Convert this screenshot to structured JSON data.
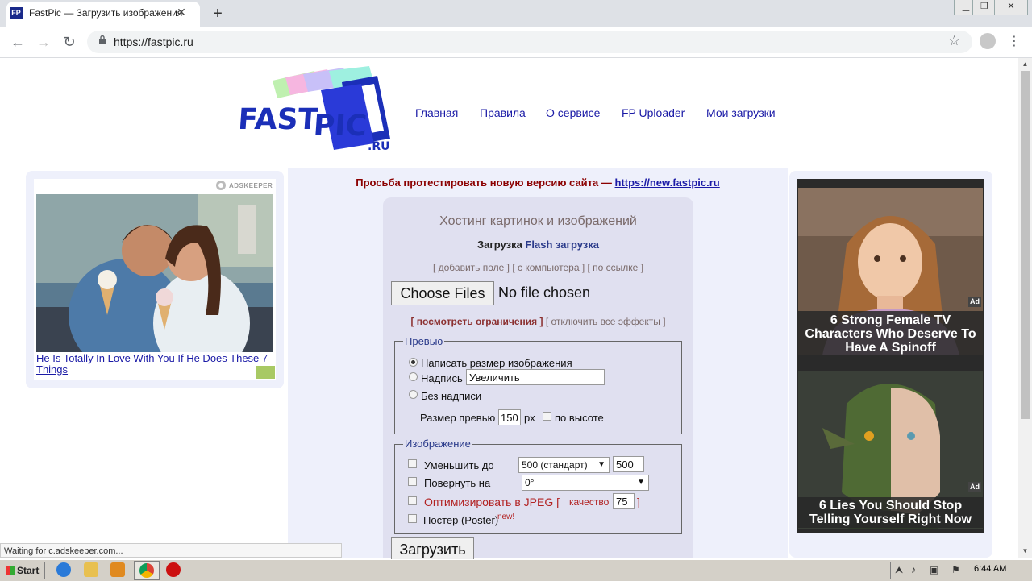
{
  "browser": {
    "tab_title": "FastPic — Загрузить изображения",
    "favicon_text": "FP",
    "url": "https://fastpic.ru",
    "status_text": "Waiting for c.adskeeper.com..."
  },
  "site": {
    "nav": [
      "Главная",
      "Правила",
      "О сервисе",
      "FP Uploader",
      "Мои загрузки"
    ],
    "notice_text": "Просьба протестировать новую версию сайта — ",
    "notice_link": "https://new.fastpic.ru"
  },
  "left_ad": {
    "brand": "ADSKEEPER",
    "headline": "He Is Totally In Love With You If He Does These 7 Things"
  },
  "upload": {
    "title": "Хостинг картинок и изображений",
    "mode_label": "Загрузка",
    "flash_label": "Flash загрузка",
    "options": "[ добавить поле ] [ с компьютера ] [ по ссылке ]",
    "choose_files": "Choose Files",
    "no_file": "No file chosen",
    "limits": "[ посмотреть ограничения ]",
    "effects": " [ отключить все эффекты ]",
    "preview": {
      "legend": "Превью",
      "opt1": "Написать размер изображения",
      "opt2": "Надпись",
      "opt2_value": "Увеличить",
      "opt3": "Без надписи",
      "size_label": "Размер превью",
      "size_value": "150",
      "size_unit": "px",
      "by_height": "по высоте"
    },
    "image": {
      "legend": "Изображение",
      "resize": "Уменьшить до",
      "resize_select": "500 (стандарт)",
      "resize_value": "500",
      "rotate": "Повернуть на",
      "rotate_select": "0°",
      "optimize": "Оптимизировать в JPEG [",
      "quality_label": "качество",
      "quality_value": "75",
      "bracket_close": "]",
      "poster": "Постер (Poster)",
      "poster_new": "new!"
    },
    "submit": "Загрузить"
  },
  "right_ads": [
    {
      "caption": "6 Strong Female TV Characters Who Deserve To Have A Spinoff",
      "badge": "Ad"
    },
    {
      "caption": "6 Lies You Should Stop Telling Yourself Right Now",
      "badge": "Ad"
    }
  ],
  "taskbar": {
    "start": "Start",
    "clock": "6:44 AM"
  }
}
